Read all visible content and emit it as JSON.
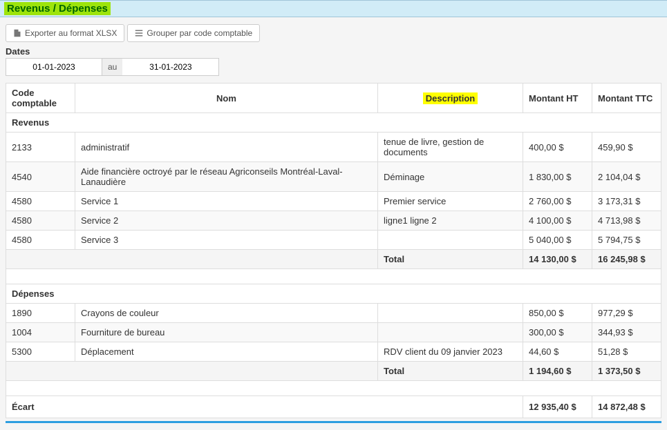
{
  "header": {
    "title": "Revenus / Dépenses"
  },
  "toolbar": {
    "export_label": "Exporter au format XLSX",
    "group_label": "Grouper par code comptable"
  },
  "dates": {
    "label": "Dates",
    "from": "01-01-2023",
    "sep": "au",
    "to": "31-01-2023"
  },
  "columns": {
    "code": "Code comptable",
    "name": "Nom",
    "desc": "Description",
    "ht": "Montant HT",
    "ttc": "Montant TTC"
  },
  "sections": {
    "revenus": {
      "label": "Revenus",
      "rows": [
        {
          "code": "2133",
          "name": "administratif",
          "desc": "tenue de livre, gestion de documents",
          "ht": "400,00 $",
          "ttc": "459,90 $"
        },
        {
          "code": "4540",
          "name": "Aide financière octroyé par le réseau Agriconseils Montréal-Laval-Lanaudière",
          "desc": "Déminage",
          "ht": "1 830,00 $",
          "ttc": "2 104,04 $"
        },
        {
          "code": "4580",
          "name": "Service 1",
          "desc": "Premier service",
          "ht": "2 760,00 $",
          "ttc": "3 173,31 $"
        },
        {
          "code": "4580",
          "name": "Service 2",
          "desc": "ligne1 ligne 2",
          "ht": "4 100,00 $",
          "ttc": "4 713,98 $"
        },
        {
          "code": "4580",
          "name": "Service 3",
          "desc": "",
          "ht": "5 040,00 $",
          "ttc": "5 794,75 $"
        }
      ],
      "total_label": "Total",
      "total_ht": "14 130,00 $",
      "total_ttc": "16 245,98 $"
    },
    "depenses": {
      "label": "Dépenses",
      "rows": [
        {
          "code": "1890",
          "name": "Crayons de couleur",
          "desc": "",
          "ht": "850,00 $",
          "ttc": "977,29 $"
        },
        {
          "code": "1004",
          "name": "Fourniture de bureau",
          "desc": "",
          "ht": "300,00 $",
          "ttc": "344,93 $"
        },
        {
          "code": "5300",
          "name": "Déplacement",
          "desc": "RDV client du 09 janvier 2023",
          "ht": "44,60 $",
          "ttc": "51,28 $"
        }
      ],
      "total_label": "Total",
      "total_ht": "1 194,60 $",
      "total_ttc": "1 373,50 $"
    }
  },
  "ecart": {
    "label": "Écart",
    "ht": "12 935,40 $",
    "ttc": "14 872,48 $"
  }
}
